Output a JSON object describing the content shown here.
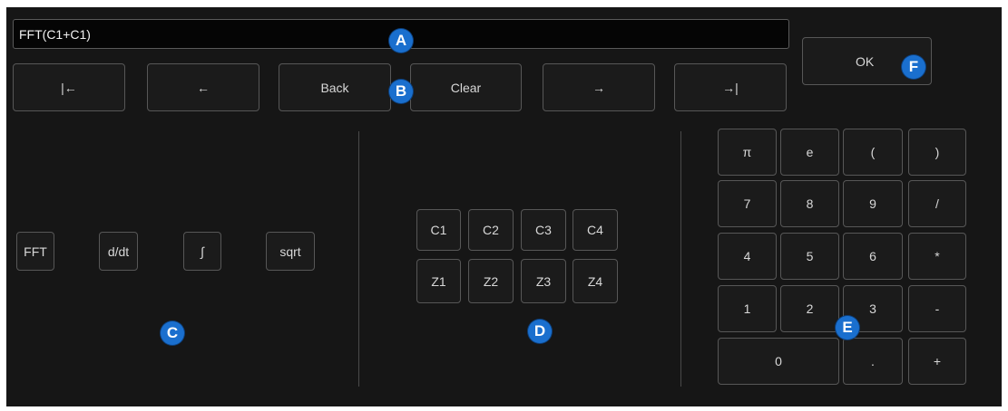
{
  "expression": {
    "value": "FFT(C1+C1)"
  },
  "nav": {
    "home": "|←",
    "left": "←",
    "back": "Back",
    "clear": "Clear",
    "right": "→",
    "end": "→|"
  },
  "ok_label": "OK",
  "functions": [
    "FFT",
    "d/dt",
    "∫",
    "sqrt"
  ],
  "sources": {
    "row1": [
      "C1",
      "C2",
      "C3",
      "C4"
    ],
    "row2": [
      "Z1",
      "Z2",
      "Z3",
      "Z4"
    ]
  },
  "keypad": {
    "row1": [
      "π",
      "e",
      "(",
      ")"
    ],
    "row2": [
      "7",
      "8",
      "9",
      "/"
    ],
    "row3": [
      "4",
      "5",
      "6",
      "*"
    ],
    "row4": [
      "1",
      "2",
      "3",
      "-"
    ],
    "row5": [
      "0",
      ".",
      "+"
    ]
  },
  "callouts": {
    "a": "A",
    "b": "B",
    "c": "C",
    "d": "D",
    "e": "E",
    "f": "F"
  },
  "colors": {
    "background": "#161616",
    "button_border": "#575757",
    "callout": "#1a6fce"
  }
}
